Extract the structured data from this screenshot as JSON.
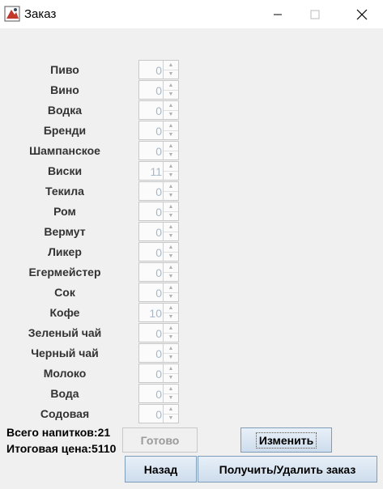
{
  "window": {
    "title": "Заказ"
  },
  "drinks": [
    {
      "label": "Пиво",
      "value": "0"
    },
    {
      "label": "Вино",
      "value": "0"
    },
    {
      "label": "Водка",
      "value": "0"
    },
    {
      "label": "Бренди",
      "value": "0"
    },
    {
      "label": "Шампанское",
      "value": "0"
    },
    {
      "label": "Виски",
      "value": "11"
    },
    {
      "label": "Текила",
      "value": "0"
    },
    {
      "label": "Ром",
      "value": "0"
    },
    {
      "label": "Вермут",
      "value": "0"
    },
    {
      "label": "Ликер",
      "value": "0"
    },
    {
      "label": "Егермейстер",
      "value": "0"
    },
    {
      "label": "Сок",
      "value": "0"
    },
    {
      "label": "Кофе",
      "value": "10"
    },
    {
      "label": "Зеленый чай",
      "value": "0"
    },
    {
      "label": "Черный чай",
      "value": "0"
    },
    {
      "label": "Молоко",
      "value": "0"
    },
    {
      "label": "Вода",
      "value": "0"
    },
    {
      "label": "Содовая",
      "value": "0"
    }
  ],
  "summary": {
    "total_drinks": "Всего напитков:21",
    "total_price": "Итоговая цена:5110"
  },
  "buttons": {
    "ready": "Готово",
    "change": "Изменить",
    "back": "Назад",
    "get_delete": "Получить/Удалить заказ"
  },
  "icons": {
    "app": "app-icon",
    "minimize": "minimize-icon",
    "maximize": "maximize-icon",
    "close": "close-icon",
    "spin_up": "chevron-up-icon",
    "spin_down": "chevron-down-icon"
  }
}
